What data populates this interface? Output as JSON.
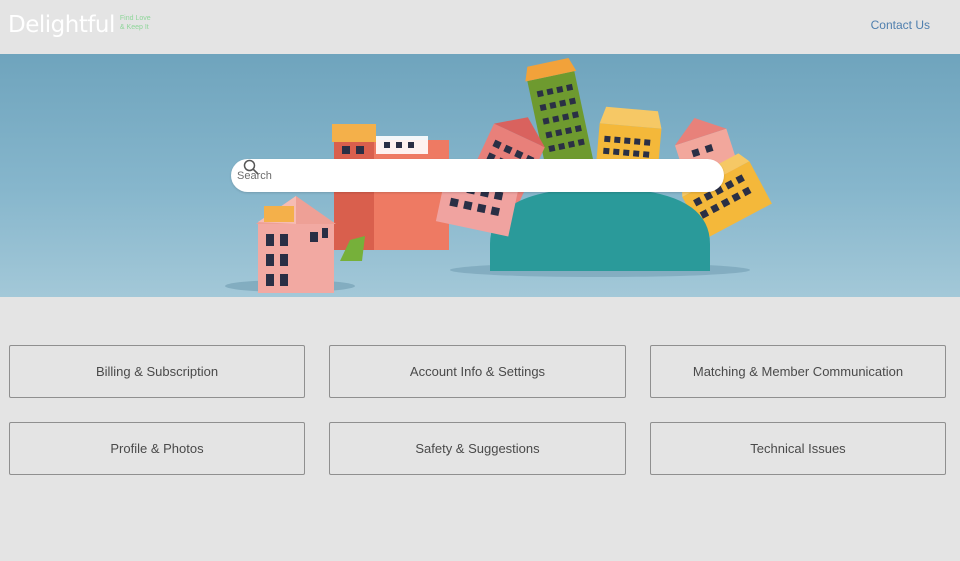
{
  "header": {
    "logo_text": "Delightful",
    "tagline_line1": "Find Love",
    "tagline_line2": "& Keep It",
    "contact_label": "Contact Us"
  },
  "hero": {
    "illustration": "paper-houses"
  },
  "search": {
    "placeholder": "Search",
    "icon": "search-icon"
  },
  "categories": [
    {
      "label": "Billing & Subscription"
    },
    {
      "label": "Account Info & Settings"
    },
    {
      "label": "Matching & Member Communication"
    },
    {
      "label": "Profile & Photos"
    },
    {
      "label": "Safety & Suggestions"
    },
    {
      "label": "Technical Issues"
    }
  ],
  "colors": {
    "background": "#e4e4e4",
    "link": "#4f7fae",
    "tagline": "#8fd69a"
  }
}
